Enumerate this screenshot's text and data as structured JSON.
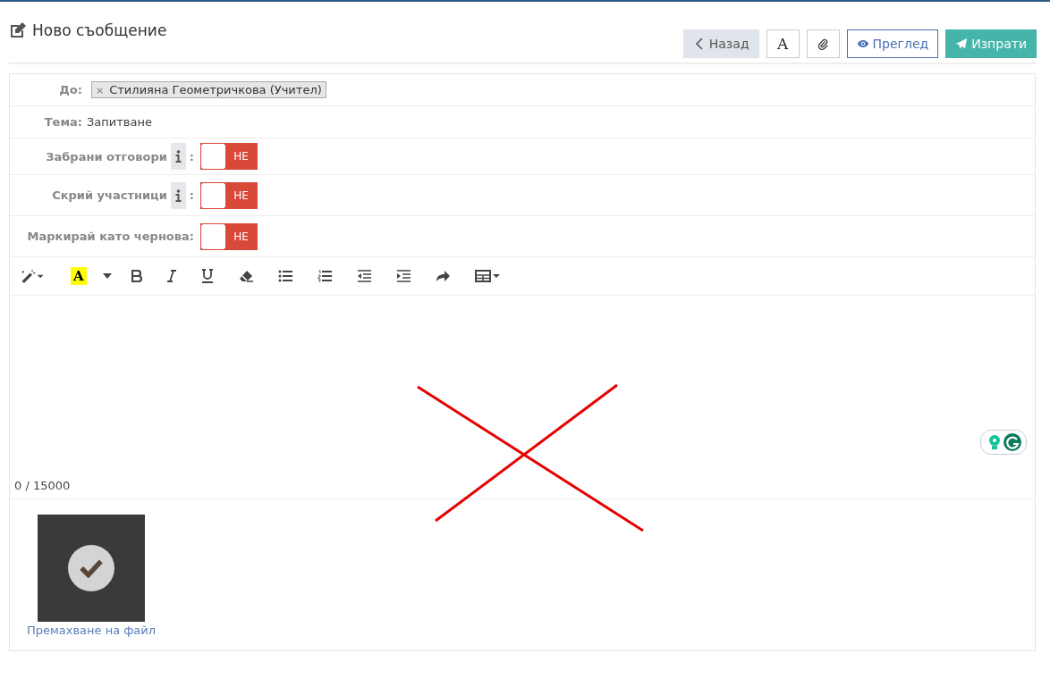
{
  "header": {
    "title": "Ново съобщение"
  },
  "actions": [
    {
      "kind": "back",
      "label": "Назад"
    },
    {
      "kind": "font",
      "label": "A"
    },
    {
      "kind": "attach"
    },
    {
      "kind": "preview",
      "label": "Преглед"
    },
    {
      "kind": "send",
      "label": "Изпрати"
    }
  ],
  "recipients": {
    "label": "До:",
    "tags": [
      "Стилияна Геометричкова (Учител)"
    ],
    "remove_mark": "×"
  },
  "subject": {
    "label": "Тема:",
    "value": "Запитване"
  },
  "toggles": [
    {
      "label": "Забрани отговори",
      "info": true,
      "colon": ":",
      "on": false,
      "state_text": "НЕ"
    },
    {
      "label": "Скрий участници",
      "info": true,
      "colon": ":",
      "on": false,
      "state_text": "НЕ"
    },
    {
      "label": "Маркирай като чернова:",
      "info": false,
      "on": false,
      "state_text": "НЕ"
    }
  ],
  "toolbar": [
    {
      "kind": "magic"
    },
    {
      "kind": "highlight",
      "label": "A"
    },
    {
      "kind": "caret"
    },
    {
      "kind": "bold"
    },
    {
      "kind": "italic"
    },
    {
      "kind": "underline"
    },
    {
      "kind": "eraser"
    },
    {
      "kind": "bullets"
    },
    {
      "kind": "numbers"
    },
    {
      "kind": "outdent"
    },
    {
      "kind": "indent"
    },
    {
      "kind": "redo"
    },
    {
      "kind": "table"
    }
  ],
  "editor": {
    "counter": "0 / 15000"
  },
  "attachments": [
    {
      "remove_link": "Премахване на файл",
      "checked": true
    }
  ]
}
